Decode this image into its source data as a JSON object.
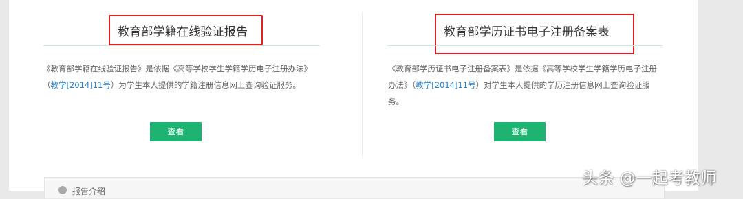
{
  "cards": [
    {
      "title": "教育部学籍在线验证报告",
      "desc_before": "《教育部学籍在线验证报告》是依据《高等学校学生学籍学历电子注册办法》（",
      "desc_link": "教学[2014]11号",
      "desc_after": "）为学生本人提供的学籍注册信息网上查询验证服务。",
      "button_label": "查看"
    },
    {
      "title": "教育部学历证书电子注册备案表",
      "desc_before": "《教育部学历证书电子注册备案表》是依据《高等学校学生学籍学历电子注册办法》（",
      "desc_link": "教学[2014]11号",
      "desc_after": "）对学生本人提供的学历注册信息网上查询验证服务。",
      "button_label": "查看"
    }
  ],
  "bottom_section": {
    "label": "报告介绍"
  },
  "watermark": "头条 @一起考教师",
  "colors": {
    "button": "#1fb371",
    "link": "#2a7fc9",
    "highlight_box": "#e02020"
  }
}
